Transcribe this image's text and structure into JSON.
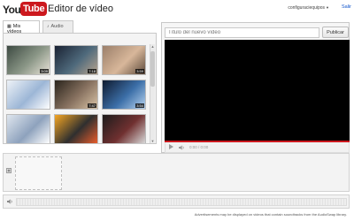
{
  "header": {
    "logo_you": "You",
    "logo_tube": "Tube",
    "title": "Editor de vídeo",
    "account": "configuraciequipos",
    "signout": "Salir"
  },
  "library": {
    "tabs": [
      {
        "label": "Mis vídeos",
        "icon": "film-icon",
        "active": true
      },
      {
        "label": "Audio",
        "icon": "music-note-icon",
        "active": false
      }
    ],
    "thumbnails": [
      {
        "duration": "3:09",
        "colors": [
          "#3d4a42",
          "#8c9888",
          "#e9e3d8"
        ]
      },
      {
        "duration": "7:18",
        "colors": [
          "#1a2233",
          "#4f6a7c",
          "#b8a48e"
        ]
      },
      {
        "duration": "3:59",
        "colors": [
          "#9b7f6a",
          "#d8b79a",
          "#5d4a3c"
        ]
      },
      {
        "duration": "",
        "colors": [
          "#eef2f7",
          "#9cb6d6",
          "#ffffff"
        ]
      },
      {
        "duration": "7:47",
        "colors": [
          "#2a241c",
          "#8a7462",
          "#d9c3a6"
        ]
      },
      {
        "duration": "3:54",
        "colors": [
          "#0f1a2e",
          "#3c6fa8",
          "#b7d3f0"
        ]
      },
      {
        "duration": "",
        "colors": [
          "#dfe6ee",
          "#8ea2bd",
          "#ffffff"
        ]
      },
      {
        "duration": "",
        "colors": [
          "#f5a623",
          "#2f2f2f",
          "#e85d2c"
        ]
      },
      {
        "duration": "",
        "colors": [
          "#1c1c1c",
          "#703030",
          "#d6d6d6"
        ]
      }
    ],
    "brand_color": "#cc181e"
  },
  "preview": {
    "title_placeholder": "Título del nuevo vídeo",
    "publish_label": "Publicar",
    "time": "0:00 / 0:00"
  },
  "timeline": {
    "disclaimer": "Advertisements may be displayed on videos that contain soundtracks from the AudioSwap library."
  }
}
